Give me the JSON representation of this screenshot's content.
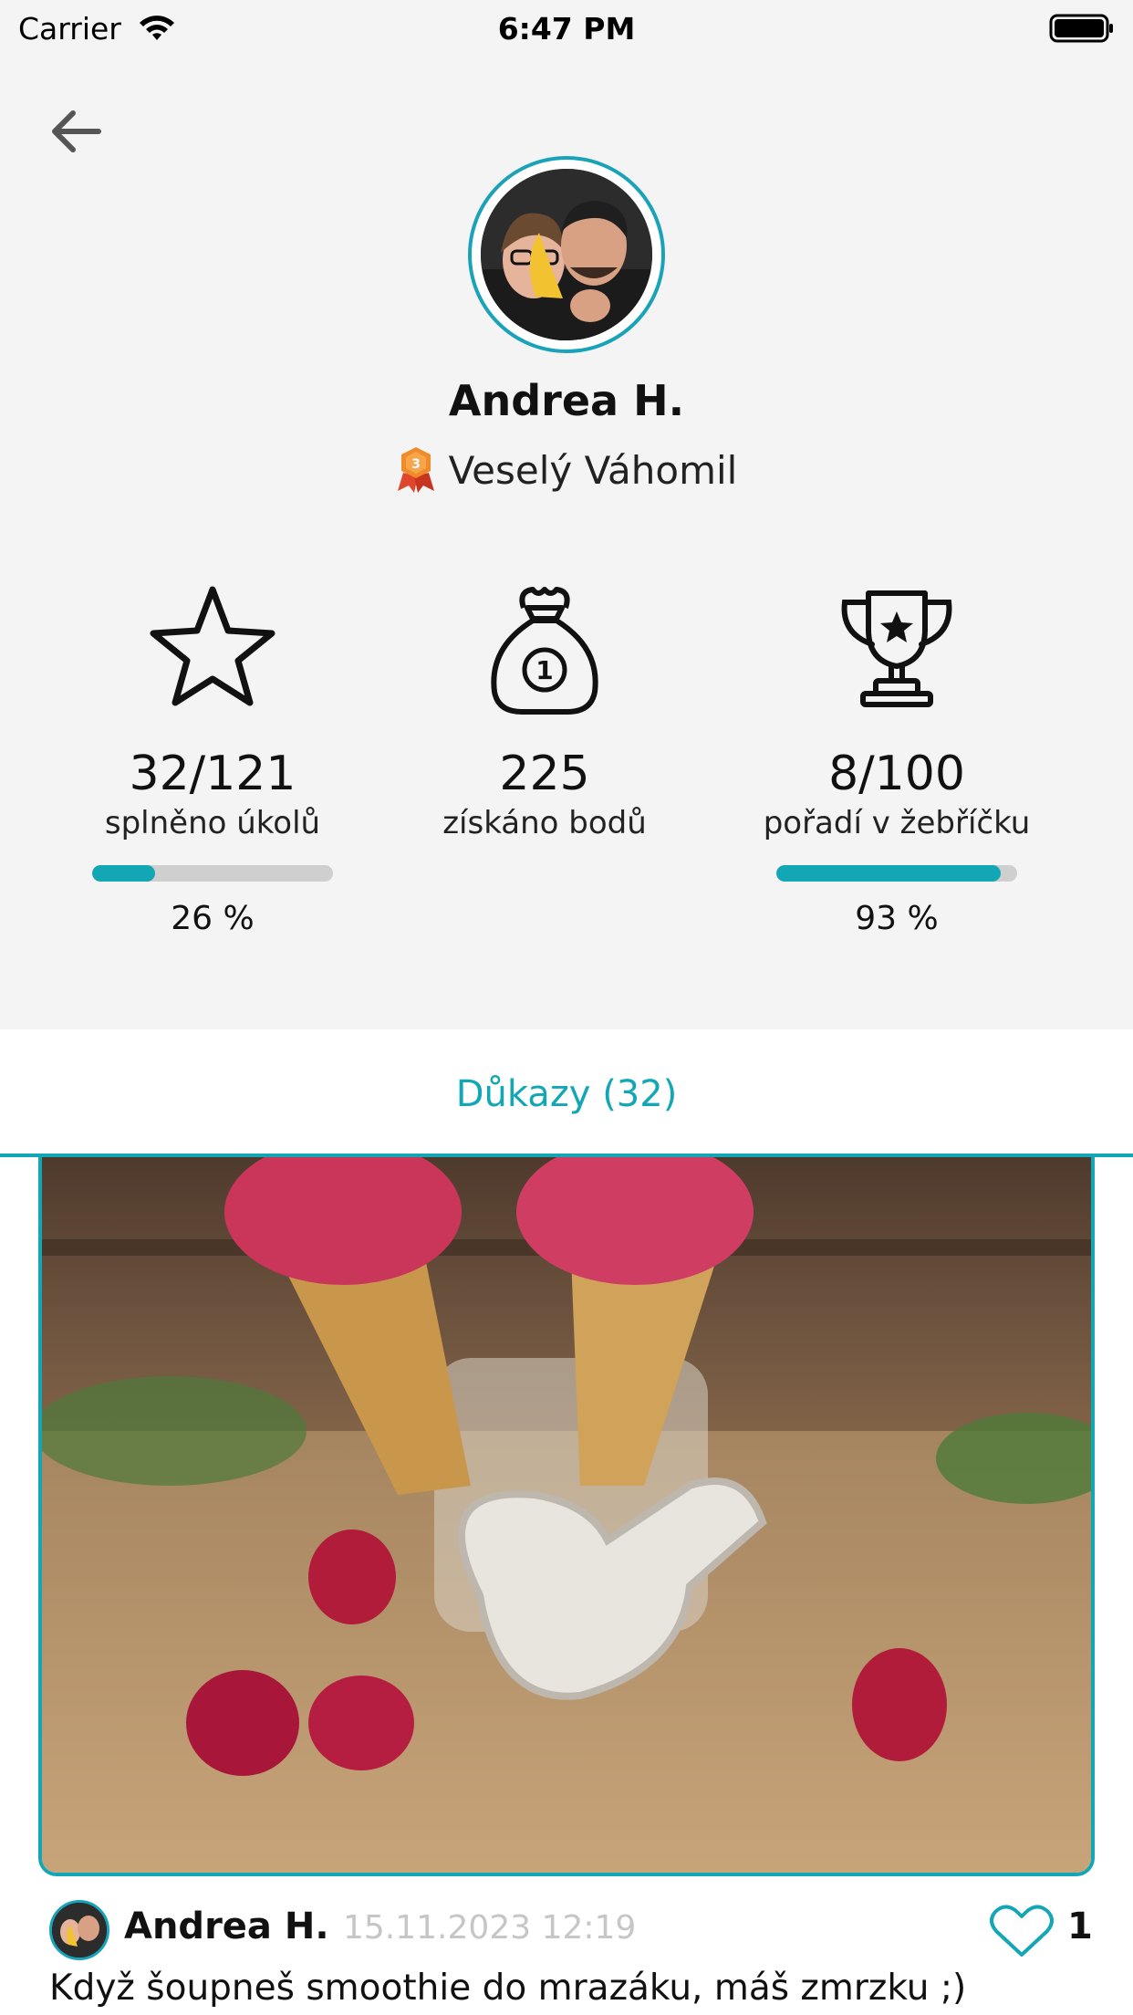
{
  "status_bar": {
    "carrier": "Carrier",
    "time": "6:47 PM",
    "wifi_icon": "wifi-icon",
    "battery_icon": "battery-icon"
  },
  "header": {
    "back_icon": "arrow-left-icon"
  },
  "profile": {
    "name": "Andrea H.",
    "rank_badge_icon": "medal-badge-icon",
    "rank_badge_number": "3",
    "rank_title": "Veselý Váhomil"
  },
  "stats": [
    {
      "icon": "star-icon",
      "value": "32/121",
      "label": "splněno úkolů",
      "progress": 0.26,
      "percent": "26 %"
    },
    {
      "icon": "money-bag-icon",
      "value": "225",
      "label": "získáno bodů"
    },
    {
      "icon": "trophy-icon",
      "value": "8/100",
      "label": "pořadí v žebříčku",
      "progress": 0.93,
      "percent": "93 %"
    }
  ],
  "tabs": [
    {
      "label": "Důkazy (32)",
      "active": true
    }
  ],
  "post": {
    "author": "Andrea H.",
    "date": "15.11.2023 12:19",
    "likes": "1",
    "like_icon": "heart-icon",
    "text": "Když šoupneš smoothie do mrazáku, máš zmrzku ;)"
  },
  "colors": {
    "accent": "#13a7b5",
    "background": "#f4f4f4",
    "progress_track": "#cfcfcf",
    "date_text": "#c6c6c6"
  }
}
